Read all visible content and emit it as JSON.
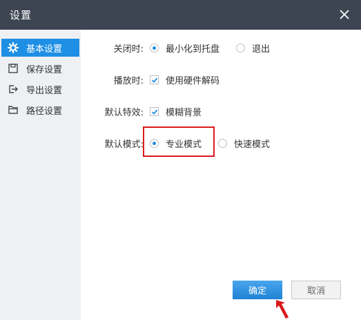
{
  "window": {
    "title": "设置"
  },
  "sidebar": {
    "items": [
      {
        "label": "基本设置",
        "icon": "gear-icon",
        "active": true
      },
      {
        "label": "保存设置",
        "icon": "save-icon",
        "active": false
      },
      {
        "label": "导出设置",
        "icon": "export-icon",
        "active": false
      },
      {
        "label": "路径设置",
        "icon": "folder-icon",
        "active": false
      }
    ]
  },
  "settings": {
    "close_behavior": {
      "label": "关闭时:",
      "options": [
        "最小化到托盘",
        "退出"
      ],
      "selected": "最小化到托盘"
    },
    "playback": {
      "label": "播放时:",
      "checkbox_label": "使用硬件解码",
      "checked": true
    },
    "default_effect": {
      "label": "默认特效:",
      "checkbox_label": "模糊背景",
      "checked": true
    },
    "default_mode": {
      "label": "默认模式:",
      "options": [
        "专业模式",
        "快速模式"
      ],
      "selected": "专业模式"
    }
  },
  "buttons": {
    "ok": "确定",
    "cancel": "取消"
  },
  "colors": {
    "titlebar": "#3d4452",
    "accent": "#1f8fe5",
    "highlight_box": "#d9191c"
  }
}
